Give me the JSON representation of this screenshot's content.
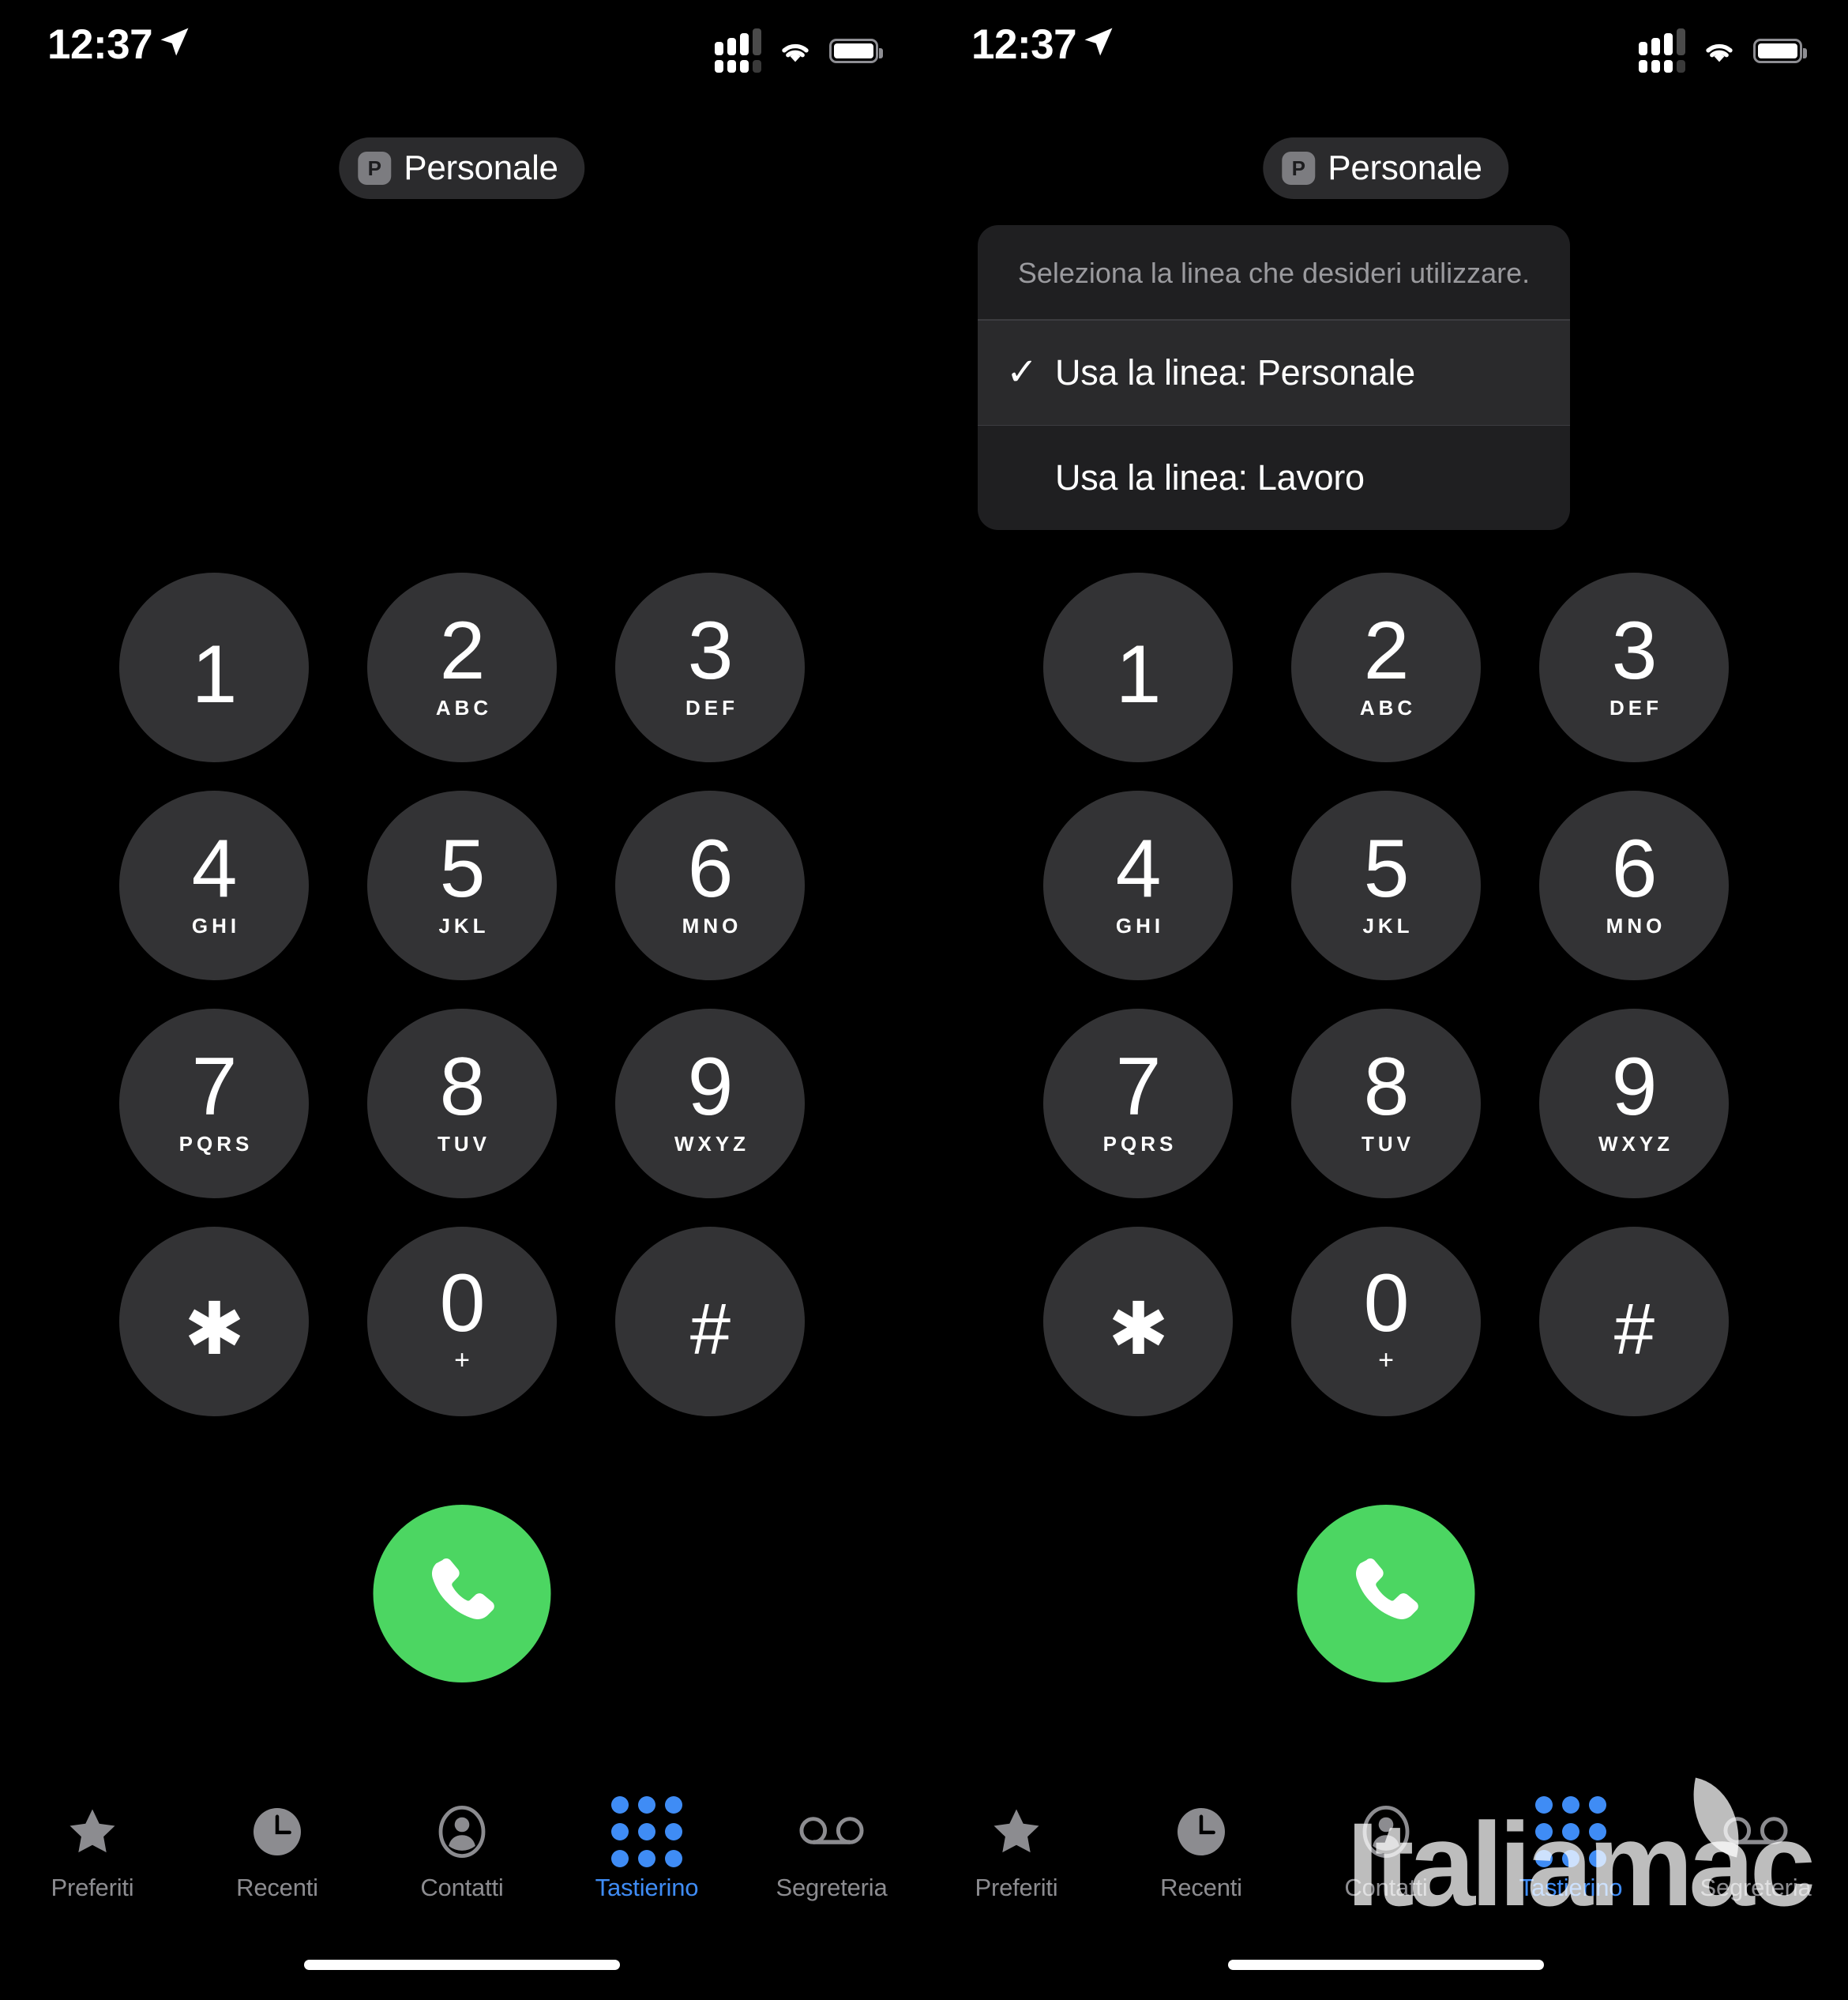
{
  "status_bar": {
    "time": "12:37",
    "location_icon": "location-arrow-icon",
    "signal_icon": "dual-sim-signal-icon",
    "wifi_icon": "wifi-icon",
    "battery_icon": "battery-icon"
  },
  "line_pill": {
    "badge": "P",
    "label": "Personale"
  },
  "action_sheet": {
    "title": "Seleziona la linea che desideri utilizzare.",
    "items": [
      {
        "label": "Usa la linea: Personale",
        "checked": true,
        "check_glyph": "✓"
      },
      {
        "label": "Usa la linea: Lavoro",
        "checked": false,
        "check_glyph": "✓"
      }
    ]
  },
  "keypad": {
    "keys": [
      {
        "digit": "1",
        "letters": ""
      },
      {
        "digit": "2",
        "letters": "ABC"
      },
      {
        "digit": "3",
        "letters": "DEF"
      },
      {
        "digit": "4",
        "letters": "GHI"
      },
      {
        "digit": "5",
        "letters": "JKL"
      },
      {
        "digit": "6",
        "letters": "MNO"
      },
      {
        "digit": "7",
        "letters": "PQRS"
      },
      {
        "digit": "8",
        "letters": "TUV"
      },
      {
        "digit": "9",
        "letters": "WXYZ"
      },
      {
        "digit": "✱",
        "letters": ""
      },
      {
        "digit": "0",
        "letters": "+"
      },
      {
        "digit": "#",
        "letters": ""
      }
    ]
  },
  "call_button": {
    "icon": "phone-icon",
    "color": "#4cd662"
  },
  "tab_bar": {
    "tabs": [
      {
        "label": "Preferiti",
        "icon": "star-icon",
        "active": false
      },
      {
        "label": "Recenti",
        "icon": "clock-icon",
        "active": false
      },
      {
        "label": "Contatti",
        "icon": "person-icon",
        "active": false
      },
      {
        "label": "Tastierino",
        "icon": "keypad-icon",
        "active": true
      },
      {
        "label": "Segreteria",
        "icon": "voicemail-icon",
        "active": false
      }
    ],
    "active_color": "#3f8cf5",
    "inactive_color": "#8c8c90"
  },
  "watermark": {
    "text": "Italiamac"
  }
}
